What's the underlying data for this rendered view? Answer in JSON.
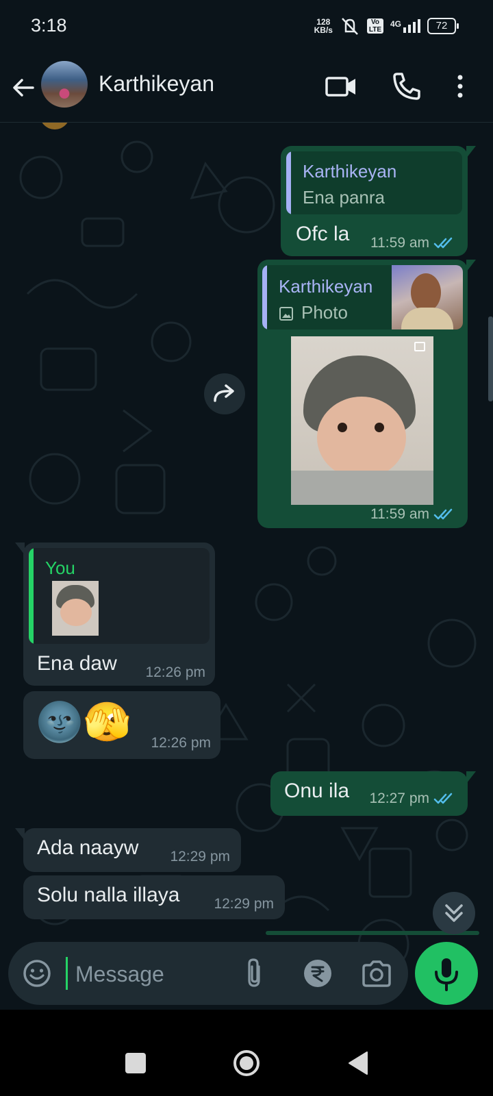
{
  "status_bar": {
    "time": "3:18",
    "net_speed_value": "128",
    "net_speed_unit": "KB/s",
    "volte": "Vo LTE",
    "network": "4G",
    "battery": "72"
  },
  "header": {
    "contact_name": "Karthikeyan"
  },
  "messages": {
    "m1": {
      "quote_author": "Karthikeyan",
      "quote_text": "Ena panra",
      "text": "Ofc la",
      "time": "11:59 am"
    },
    "m2": {
      "quote_author": "Karthikeyan",
      "quote_text": "Photo",
      "time": "11:59 am"
    },
    "m3": {
      "quote_author": "You",
      "text": "Ena daw",
      "time": "12:26 pm"
    },
    "m4": {
      "text": "🌚🫣",
      "time": "12:26 pm"
    },
    "m5": {
      "text": "Onu ila",
      "time": "12:27 pm"
    },
    "m6": {
      "text": "Ada naayw",
      "time": "12:29 pm"
    },
    "m7": {
      "text": "Solu nalla illaya",
      "time": "12:29 pm"
    }
  },
  "composer": {
    "placeholder": "Message"
  },
  "colors": {
    "accent": "#21c063",
    "outgoing": "#144d37",
    "incoming": "#202c33",
    "tick_read": "#53bdeb"
  }
}
